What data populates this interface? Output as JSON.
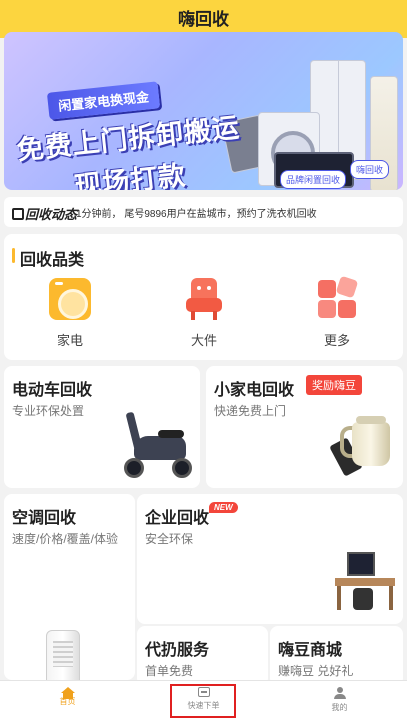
{
  "header": {
    "title": "嗨回收"
  },
  "banner": {
    "pill": "闲置家电换现金",
    "headline_1": "免费上门拆卸搬运",
    "headline_2": "现场打款",
    "tag_1": "品牌闲置回收",
    "tag_2": "嗨回收"
  },
  "news": {
    "logo": "回收动态",
    "text": "1分钟前，  尾号9896用户在盐城市，预约了洗衣机回收"
  },
  "categories": {
    "title": "回收品类",
    "items": [
      {
        "label": "家电",
        "icon": "washer-icon"
      },
      {
        "label": "大件",
        "icon": "armchair-icon"
      },
      {
        "label": "更多",
        "icon": "more-grid-icon"
      }
    ]
  },
  "cards": {
    "ev": {
      "title": "电动车回收",
      "subtitle": "专业环保处置"
    },
    "small_appliance": {
      "title": "小家电回收",
      "badge": "奖励嗨豆",
      "subtitle": "快递免费上门"
    },
    "aircon": {
      "title": "空调回收",
      "subtitle": "速度/价格/覆盖/体验"
    },
    "corp": {
      "title": "企业回收",
      "badge": "NEW",
      "subtitle": "安全环保"
    },
    "disposal": {
      "title": "代扔服务",
      "subtitle": "首单免费"
    },
    "mall": {
      "title": "嗨豆商城",
      "subtitle": "赚嗨豆 兑好礼"
    }
  },
  "tabbar": {
    "active": "home",
    "tabs": [
      {
        "label": "首页",
        "icon": "home-icon"
      },
      {
        "label": "快速下单",
        "icon": "order-icon"
      },
      {
        "label": "我的",
        "icon": "user-icon"
      }
    ]
  },
  "colors": {
    "brand_yellow": "#fcd53f",
    "accent_orange": "#f0a11b",
    "badge_red": "#f3463b",
    "highlight_red": "#e02020"
  }
}
